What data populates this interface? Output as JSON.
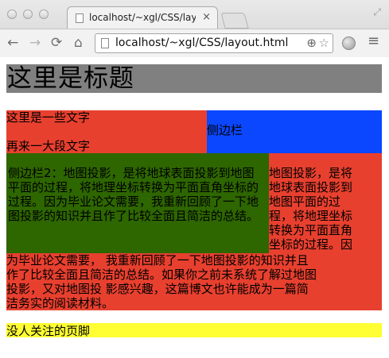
{
  "browser": {
    "tab_title": "localhost/~xgl/CSS/layout",
    "tab_close": "×",
    "url": "localhost/~xgl/CSS/layout.html",
    "nav": {
      "back": "←",
      "forward": "→",
      "reload": "⟳",
      "home": "⌂"
    },
    "zoom_glyph": "⊕",
    "star_glyph": "☆",
    "menu_glyph": "≡",
    "fullscreen_glyph": "⤢"
  },
  "page": {
    "header": "这里是标题",
    "main": {
      "line1": "这里是一些文字",
      "line2": "再来一大段文字"
    },
    "sidebar": "侧边栏",
    "sidebar2": "侧边栏2：地图投影，是将地球表面投影到地图平面的过程，将地理坐标转换为平面直角坐标的过程。因为毕业论文需要，我重新回顾了一下地图投影的知识并且作了比较全面且简洁的总结。",
    "article": {
      "right_lines": [
        "地图投影，是将",
        "地球表面投影到",
        "地图平面的过",
        "程，将地理坐标",
        "转换为平面直角",
        "坐标的过程。因"
      ],
      "bottom_lines": [
        "为毕业论文需要， 我重新回顾了一下地图投影的知识并且",
        "作了比较全面且简洁的总结。如果你之前未系统了解过地图",
        "投影，又对地图投 影感兴趣，这篇博文也许能成为一篇简",
        "洁务实的阅读材料。"
      ]
    },
    "footer": "没人关注的页脚"
  },
  "colors": {
    "header": "#808080",
    "main": "#e8402f",
    "sidebar": "#0a47ff",
    "sidebar2": "#2e6600",
    "article": "#e8402f",
    "footer": "#ffff33"
  }
}
